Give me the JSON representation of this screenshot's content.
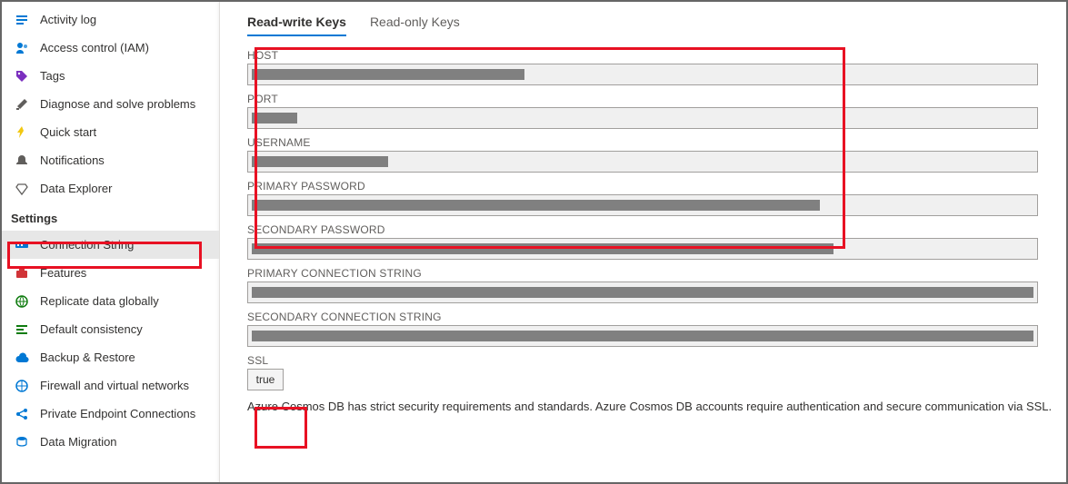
{
  "sidebar": {
    "items_top": [
      {
        "label": "Activity log",
        "icon": "activity-log-icon",
        "color": "#0078d4"
      },
      {
        "label": "Access control (IAM)",
        "icon": "access-control-icon",
        "color": "#0078d4"
      },
      {
        "label": "Tags",
        "icon": "tags-icon",
        "color": "#7b2fbf"
      },
      {
        "label": "Diagnose and solve problems",
        "icon": "diagnose-icon",
        "color": "#605e5c"
      },
      {
        "label": "Quick start",
        "icon": "quick-start-icon",
        "color": "#f2c811"
      },
      {
        "label": "Notifications",
        "icon": "notifications-icon",
        "color": "#605e5c"
      },
      {
        "label": "Data Explorer",
        "icon": "data-explorer-icon",
        "color": "#605e5c"
      }
    ],
    "section_header": "Settings",
    "items_settings": [
      {
        "label": "Connection String",
        "icon": "connection-string-icon",
        "color": "#0078d4",
        "selected": true
      },
      {
        "label": "Features",
        "icon": "features-icon",
        "color": "#d13438"
      },
      {
        "label": "Replicate data globally",
        "icon": "replicate-icon",
        "color": "#107c10"
      },
      {
        "label": "Default consistency",
        "icon": "consistency-icon",
        "color": "#107c10"
      },
      {
        "label": "Backup & Restore",
        "icon": "backup-icon",
        "color": "#0078d4"
      },
      {
        "label": "Firewall and virtual networks",
        "icon": "firewall-icon",
        "color": "#0078d4"
      },
      {
        "label": "Private Endpoint Connections",
        "icon": "private-endpoint-icon",
        "color": "#0078d4"
      },
      {
        "label": "Data Migration",
        "icon": "data-migration-icon",
        "color": "#0078d4"
      }
    ]
  },
  "tabs": {
    "readwrite": "Read-write Keys",
    "readonly": "Read-only Keys"
  },
  "fields": [
    {
      "label": "HOST",
      "redact_width": 300
    },
    {
      "label": "PORT",
      "redact_width": 50
    },
    {
      "label": "USERNAME",
      "redact_width": 150
    },
    {
      "label": "PRIMARY PASSWORD",
      "redact_width": 625
    },
    {
      "label": "SECONDARY PASSWORD",
      "redact_width": 640
    },
    {
      "label": "PRIMARY CONNECTION STRING",
      "redact_width": 860
    },
    {
      "label": "SECONDARY CONNECTION STRING",
      "redact_width": 860
    }
  ],
  "ssl": {
    "label": "SSL",
    "value": "true"
  },
  "footer": "Azure Cosmos DB has strict security requirements and standards. Azure Cosmos DB accounts require authentication and secure communication via SSL."
}
